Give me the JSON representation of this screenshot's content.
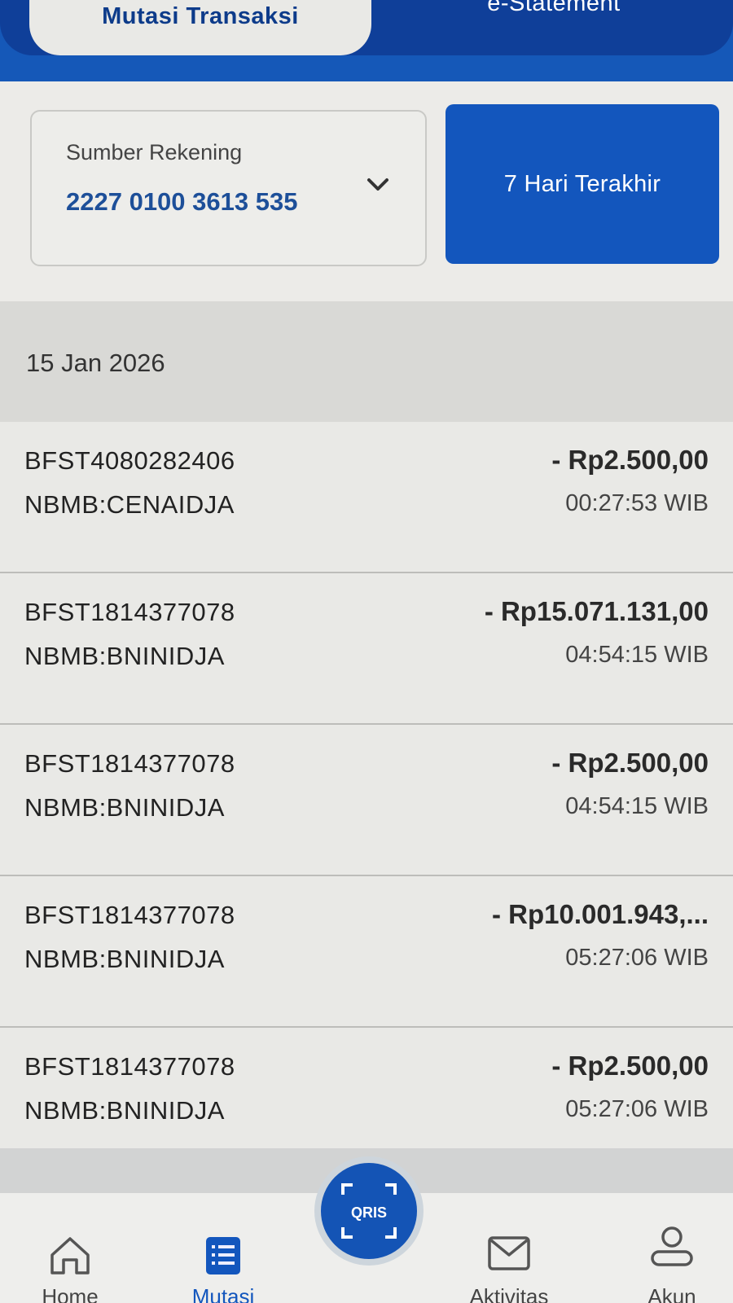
{
  "tabs": {
    "active": "Mutasi Transaksi",
    "inactive": "e-Statement"
  },
  "filter": {
    "account_label": "Sumber Rekening",
    "account_number": "2227 0100 3613 535",
    "period_label": "7 Hari Terakhir"
  },
  "date_header": "15 Jan 2026",
  "transactions": [
    {
      "ref": "BFST4080282406",
      "desc": "NBMB:CENAIDJA",
      "amount": "- Rp2.500,00",
      "time": "00:27:53 WIB"
    },
    {
      "ref": "BFST1814377078",
      "desc": "NBMB:BNINIDJA",
      "amount": "- Rp15.071.131,00",
      "time": "04:54:15 WIB"
    },
    {
      "ref": "BFST1814377078",
      "desc": "NBMB:BNINIDJA",
      "amount": "- Rp2.500,00",
      "time": "04:54:15 WIB"
    },
    {
      "ref": "BFST1814377078",
      "desc": "NBMB:BNINIDJA",
      "amount": "- Rp10.001.943,...",
      "time": "05:27:06 WIB"
    },
    {
      "ref": "BFST1814377078",
      "desc": "NBMB:BNINIDJA",
      "amount": "- Rp2.500,00",
      "time": "05:27:06 WIB"
    }
  ],
  "bottom_nav": {
    "home_label": "Home",
    "mutasi_label": "Mutasi",
    "aktivitas_label": "Aktivitas",
    "akun_label": "Akun",
    "qris_label": "QRIS"
  },
  "icons": {
    "chevron": "chevron-down-icon",
    "home": "home-icon",
    "mutasi": "list-icon",
    "qris": "qris-scan-icon",
    "aktivitas": "mail-icon",
    "akun": "profile-icon"
  },
  "colors": {
    "primary": "#1356bd",
    "primary_dark": "#0f3f99",
    "account_text": "#1d4f99"
  }
}
